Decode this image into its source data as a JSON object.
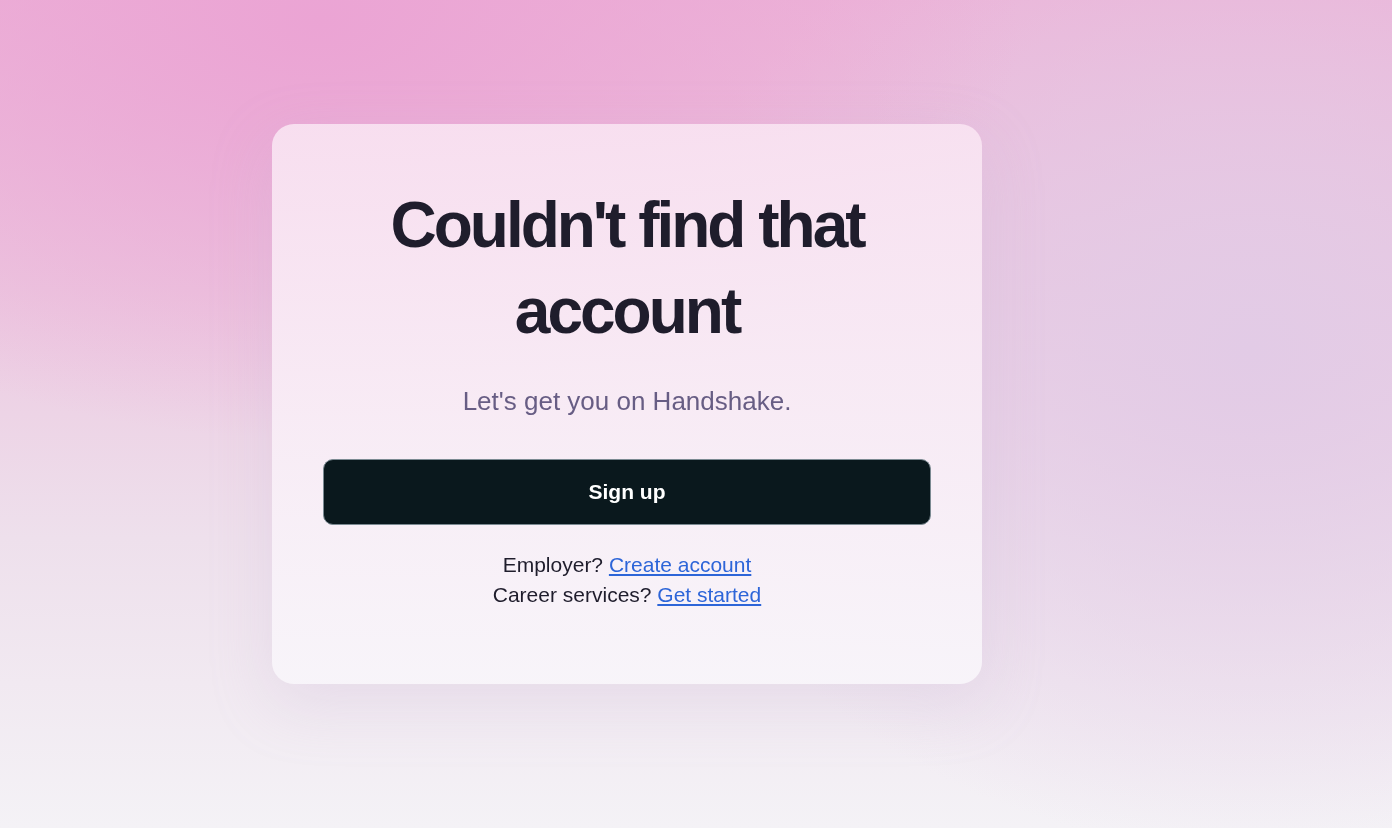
{
  "card": {
    "title": "Couldn't find that account",
    "subtitle": "Let's get you on Handshake.",
    "primary_button": "Sign up",
    "prompts": [
      {
        "text": "Employer?",
        "link": "Create account"
      },
      {
        "text": "Career services?",
        "link": "Get started"
      }
    ]
  }
}
